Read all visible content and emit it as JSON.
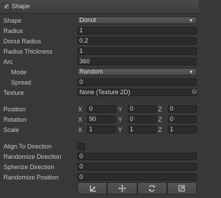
{
  "header": {
    "title": "Shape",
    "check_glyph": "✓"
  },
  "fields": {
    "shape": {
      "label": "Shape",
      "value": "Donut"
    },
    "radius": {
      "label": "Radius",
      "value": "1"
    },
    "donut_radius": {
      "label": "Donut Radius",
      "value": "0.2"
    },
    "radius_thickness": {
      "label": "Radius Thickness",
      "value": "1"
    },
    "arc": {
      "label": "Arc",
      "value": "360"
    },
    "mode": {
      "label": "Mode",
      "value": "Random"
    },
    "spread": {
      "label": "Spread",
      "value": "0"
    },
    "texture": {
      "label": "Texture",
      "value": "None (Texture 2D)"
    }
  },
  "transform": {
    "axes": {
      "x": "X",
      "y": "Y",
      "z": "Z"
    },
    "position": {
      "label": "Position",
      "x": "0",
      "y": "0",
      "z": "0"
    },
    "rotation": {
      "label": "Rotation",
      "x": "90",
      "y": "0",
      "z": "0"
    },
    "scale": {
      "label": "Scale",
      "x": "1",
      "y": "1",
      "z": "1"
    }
  },
  "direction": {
    "align": {
      "label": "Align To Direction",
      "checked": false
    },
    "randomize_direction": {
      "label": "Randomize Direction",
      "value": "0"
    },
    "spherize_direction": {
      "label": "Spherize Direction",
      "value": "0"
    },
    "randomize_position": {
      "label": "Randomize Position",
      "value": "0"
    }
  },
  "toolbar": {
    "icons": [
      "transform-gizmo-icon",
      "move-icon",
      "rotate-icon",
      "scale-icon"
    ]
  },
  "glyphs": {
    "dropdown_arrow": "▼",
    "object_picker": "⊙"
  },
  "colors": {
    "background": "#383838",
    "field": "#2b2b2b",
    "text": "#c4c4c4"
  }
}
